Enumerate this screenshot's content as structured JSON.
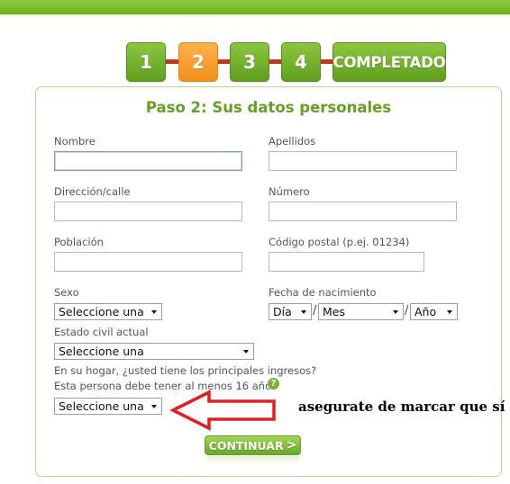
{
  "steps": [
    {
      "label": "1",
      "state": "inactive"
    },
    {
      "label": "2",
      "state": "current"
    },
    {
      "label": "3",
      "state": "inactive"
    },
    {
      "label": "4",
      "state": "inactive"
    },
    {
      "label": "COMPLETADO",
      "state": "inactive"
    }
  ],
  "form": {
    "title": "Paso 2: Sus datos personales",
    "fields": {
      "nombre": {
        "label": "Nombre",
        "value": ""
      },
      "apellidos": {
        "label": "Apellidos",
        "value": ""
      },
      "direccion": {
        "label": "Dirección/calle",
        "value": ""
      },
      "numero": {
        "label": "Número",
        "value": ""
      },
      "poblacion": {
        "label": "Población",
        "value": ""
      },
      "codigo_postal": {
        "label": "Código postal (p.ej. 01234)",
        "value": ""
      },
      "sexo": {
        "label": "Sexo",
        "selected": "Seleccione una"
      },
      "fecha_nacimiento": {
        "label": "Fecha de nacimiento",
        "day": "Día",
        "month": "Mes",
        "year": "Año",
        "separator": "/"
      },
      "estado_civil": {
        "label": "Estado civil actual",
        "selected": "Seleccione una"
      },
      "ingresos": {
        "question": "En su hogar, ¿usted tiene los principales ingresos?",
        "note": "Esta persona debe tener al menos 16 años",
        "help_icon": "?",
        "selected": "Seleccione una"
      }
    },
    "continue_label": "CONTINUAR",
    "continue_chevron": ">"
  },
  "annotation": {
    "text": "asegurate de marcar que sí",
    "arrow_color": "#e02020"
  },
  "colors": {
    "brand_green": "#6fae22",
    "title_green": "#62a123",
    "current_step_orange": "#f3901a",
    "step_connector": "#c3381c"
  }
}
